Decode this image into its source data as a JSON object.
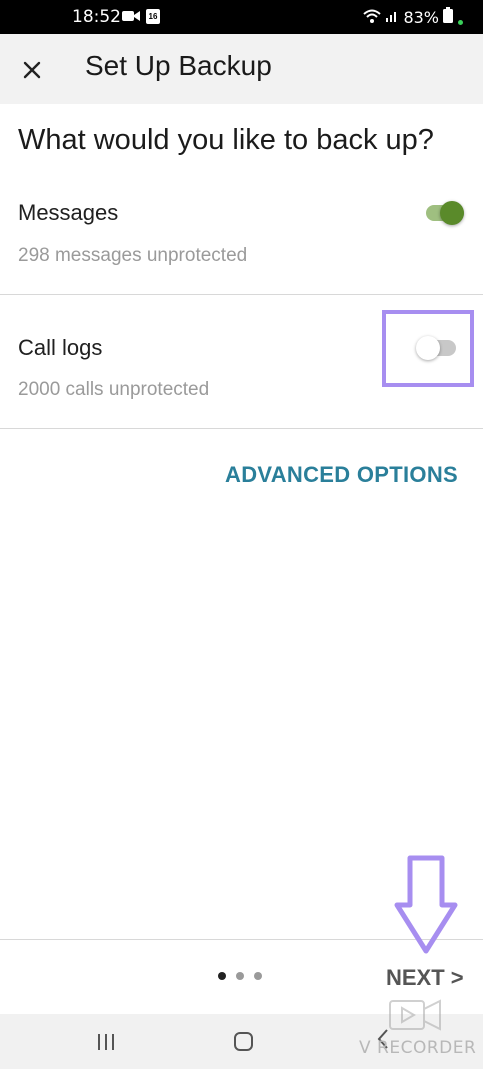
{
  "status_bar": {
    "time": "18:52",
    "calendar_day": "16",
    "battery": "83%"
  },
  "app_bar": {
    "title": "Set Up Backup",
    "close_icon": "close-icon"
  },
  "question": "What would you like to back up?",
  "items": [
    {
      "title": "Messages",
      "subtitle": "298 messages unprotected",
      "enabled": true
    },
    {
      "title": "Call logs",
      "subtitle": "2000 calls unprotected",
      "enabled": false
    }
  ],
  "advanced_options_label": "ADVANCED OPTIONS",
  "pager": {
    "count": 3,
    "active_index": 0
  },
  "next_label": "NEXT >",
  "watermark": "V RECORDER",
  "colors": {
    "toggle_on_thumb": "#5a8a2a",
    "toggle_on_track": "#9fbf80",
    "toggle_off_thumb": "#ffffff",
    "toggle_off_track": "#c8c8c8",
    "accent": "#2a7f9a",
    "highlight": "#a78ef0"
  }
}
